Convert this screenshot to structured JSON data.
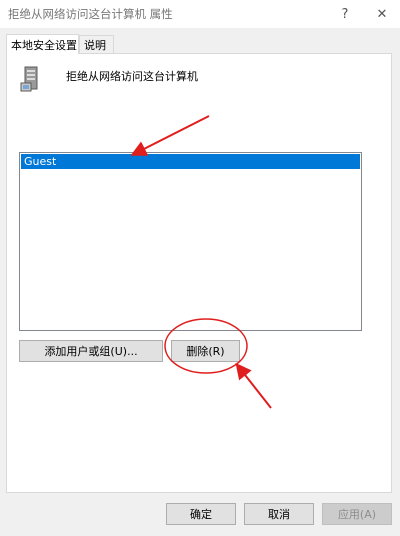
{
  "window": {
    "title": "拒绝从网络访问这台计算机 属性",
    "help_icon": "?",
    "close_icon": "✕"
  },
  "tabs": [
    {
      "label": "本地安全设置",
      "selected": true
    },
    {
      "label": "说明",
      "selected": false
    }
  ],
  "policy": {
    "name": "拒绝从网络访问这台计算机",
    "icon": "server-icon"
  },
  "list": {
    "items": [
      {
        "label": "Guest",
        "selected": true
      }
    ]
  },
  "buttons": {
    "add_label": "添加用户或组(U)...",
    "remove_label": "删除(R)",
    "ok_label": "确定",
    "cancel_label": "取消",
    "apply_label": "应用(A)"
  },
  "colors": {
    "selection": "#0078d7",
    "annotation": "#e01e1e"
  }
}
